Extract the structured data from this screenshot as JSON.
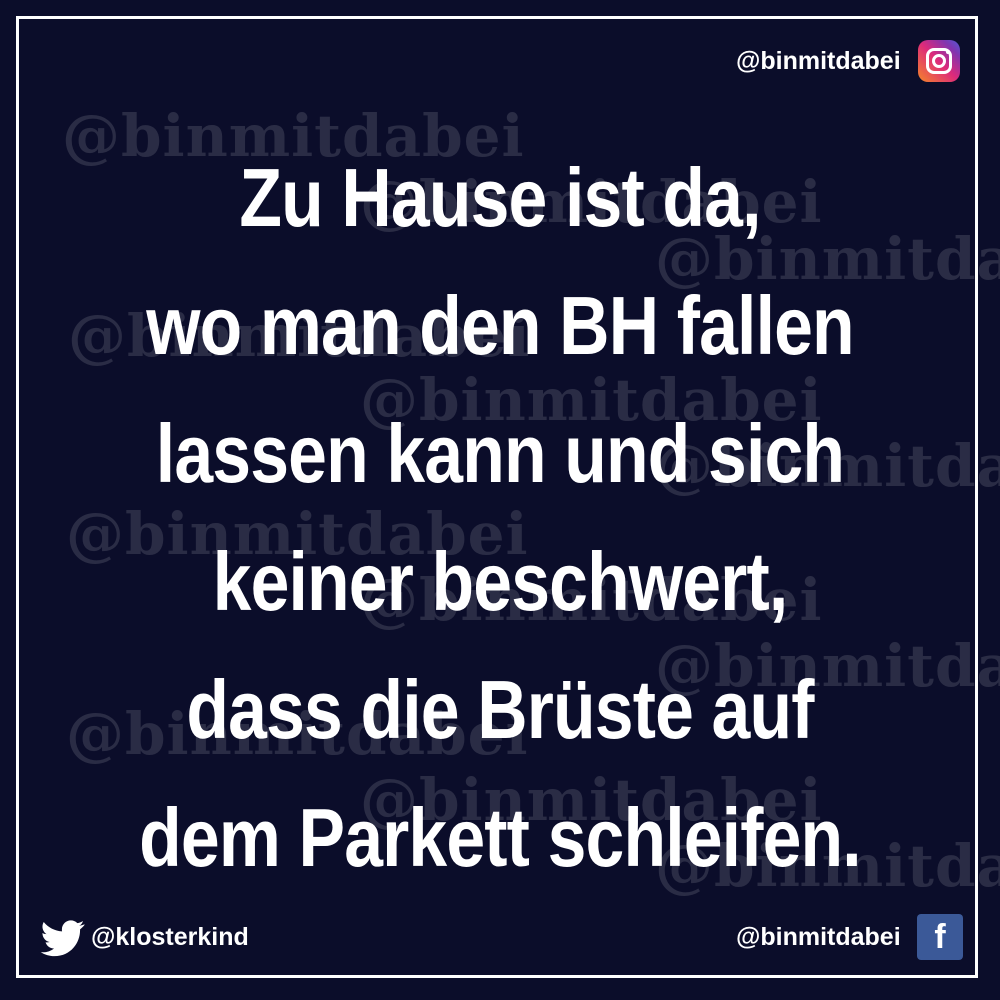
{
  "quote": {
    "lines": [
      "Zu Hause ist da,",
      "wo man den BH fallen",
      "lassen kann und sich",
      "keiner beschwert,",
      "dass die Brüste auf",
      "dem Parkett schleifen."
    ]
  },
  "handles": {
    "instagram": "@binmitdabei",
    "twitter": "@klosterkind",
    "facebook": "@binmitdabei"
  },
  "icons": {
    "instagram": "instagram-icon",
    "twitter": "twitter-bird-icon",
    "facebook": "facebook-icon",
    "facebook_glyph": "f"
  },
  "watermark": {
    "text": "@binmitdabei"
  },
  "colors": {
    "background": "#0b0d2a",
    "text": "#ffffff",
    "facebook": "#3b5998"
  }
}
